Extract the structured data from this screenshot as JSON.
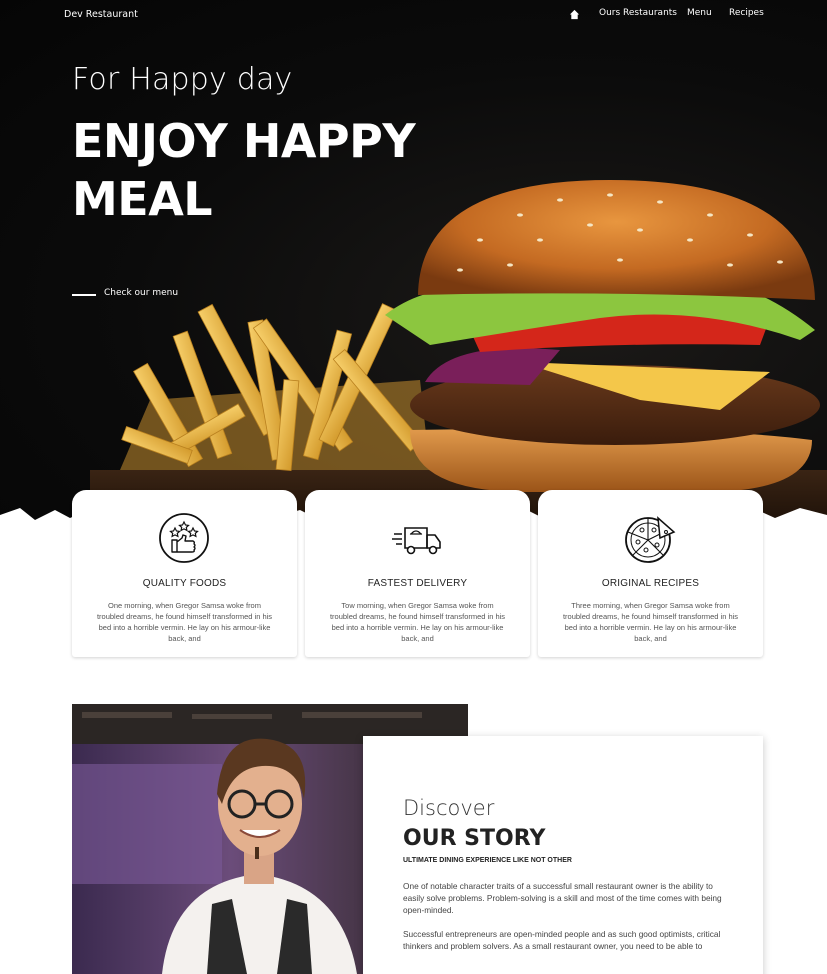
{
  "nav": {
    "brand": "Dev Restaurant",
    "links": [
      {
        "label": "Ours Restaurants"
      },
      {
        "label": "Menu"
      },
      {
        "label": "Recipes"
      }
    ],
    "home_icon": "home-icon"
  },
  "hero": {
    "subtitle": "For Happy day",
    "title": "ENJOY HAPPY MEAL",
    "cta": "Check our menu"
  },
  "features": [
    {
      "icon": "quality-stars-thumbs-up-icon",
      "title": "QUALITY FOODS",
      "text": "One morning, when Gregor Samsa woke from troubled dreams, he found himself transformed in his bed into a horrible vermin. He lay on his armour-like back, and"
    },
    {
      "icon": "delivery-truck-icon",
      "title": "FASTEST DELIVERY",
      "text": "Tow morning, when Gregor Samsa woke from troubled dreams, he found himself transformed in his bed into a horrible vermin. He lay on his armour-like back, and"
    },
    {
      "icon": "pizza-icon",
      "title": "ORIGINAL RECIPES",
      "text": "Three morning, when Gregor Samsa woke from troubled dreams, he found himself transformed in his bed into a horrible vermin. He lay on his armour-like back, and"
    }
  ],
  "story": {
    "kicker": "Discover",
    "title": "OUR STORY",
    "tagline": "ULTIMATE DINING EXPERIENCE LIKE NOT OTHER",
    "paragraphs": [
      "One of notable character traits of a successful small restaurant owner is the ability to easily solve problems. Problem-solving is a skill and most of the time comes with being open-minded.",
      "Successful entrepreneurs are open-minded people and as such good optimists, critical thinkers and problem solvers. As a small restaurant owner, you need to be able to"
    ]
  },
  "colors": {
    "hero_bg": "#0b0b0b",
    "text_light": "#ffffff",
    "card_bg": "#ffffff"
  }
}
